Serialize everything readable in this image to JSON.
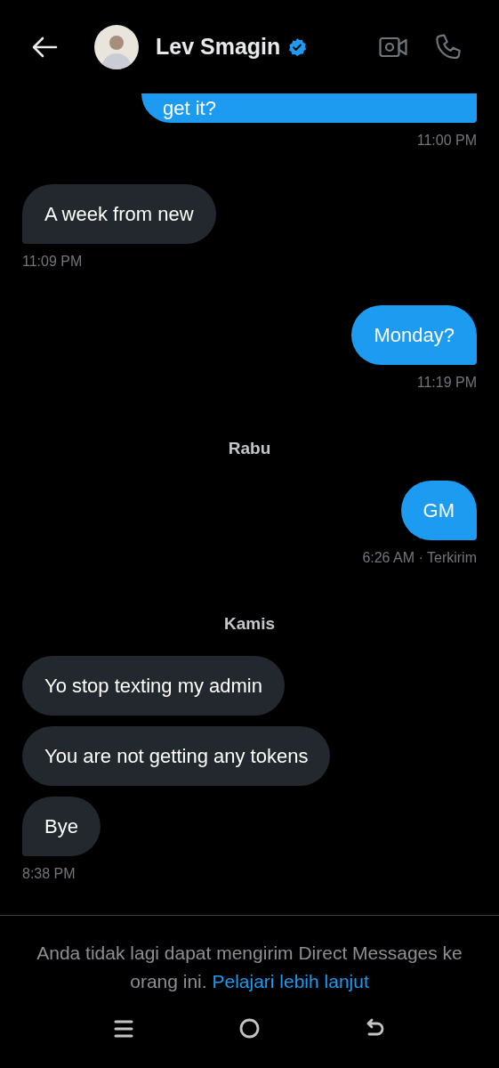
{
  "header": {
    "name": "Lev Smagin",
    "verified": true
  },
  "conversation": [
    {
      "kind": "group",
      "outgoing": true,
      "messages": [
        "get it?"
      ],
      "time": "11:00 PM"
    },
    {
      "kind": "group",
      "outgoing": false,
      "messages": [
        "A week from new"
      ],
      "time": "11:09 PM"
    },
    {
      "kind": "group",
      "outgoing": true,
      "messages": [
        "Monday?"
      ],
      "time": "11:19 PM"
    },
    {
      "kind": "date",
      "label": "Rabu"
    },
    {
      "kind": "group",
      "outgoing": true,
      "messages": [
        "GM"
      ],
      "time": "6:26 AM · Terkirim"
    },
    {
      "kind": "date",
      "label": "Kamis"
    },
    {
      "kind": "group",
      "outgoing": false,
      "messages": [
        "Yo stop texting my admin",
        "You are not getting any tokens",
        "Bye"
      ],
      "time": "8:38 PM"
    }
  ],
  "footer": {
    "notice": "Anda tidak lagi dapat mengirim Direct Messages ke orang ini.",
    "link": "Pelajari lebih lanjut"
  }
}
